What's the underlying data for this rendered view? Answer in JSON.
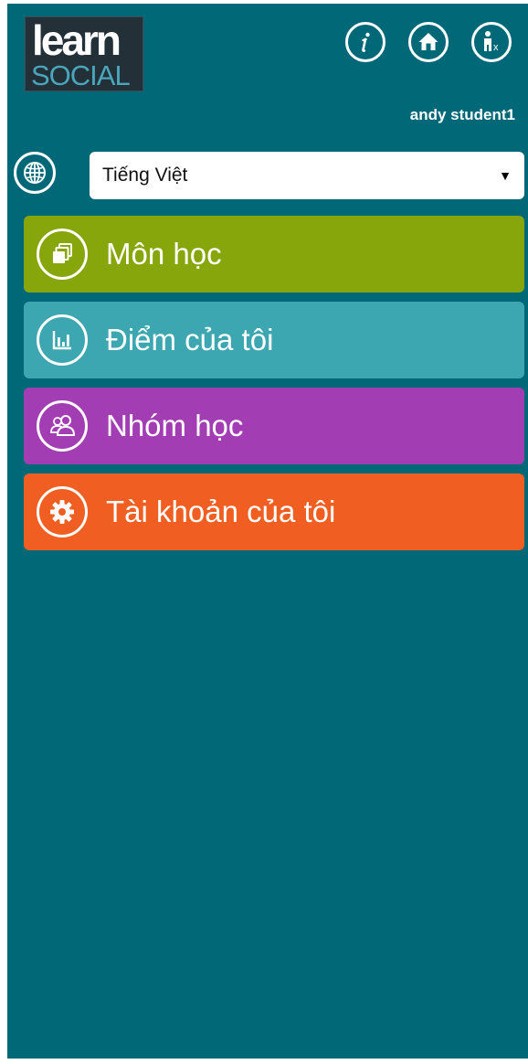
{
  "app": {
    "logo_top": "learn",
    "logo_bottom": "SOCIAL"
  },
  "header": {
    "icons": [
      "info-icon",
      "home-icon",
      "accessibility-icon"
    ],
    "user_name": "andy student1"
  },
  "language": {
    "selected": "Tiếng Việt",
    "icon": "globe-icon"
  },
  "menu": {
    "items": [
      {
        "label": "Môn học",
        "icon": "courses-icon",
        "color": "#86a60b"
      },
      {
        "label": "Điểm của tôi",
        "icon": "grades-chart-icon",
        "color": "#3ca7b1"
      },
      {
        "label": "Nhóm học",
        "icon": "groups-icon",
        "color": "#a23db3"
      },
      {
        "label": "Tài khoản của tôi",
        "icon": "settings-gear-icon",
        "color": "#f05e22"
      }
    ]
  },
  "colors": {
    "background": "#016877",
    "logo_background": "#243037",
    "logo_accent": "#4aa6bd"
  }
}
